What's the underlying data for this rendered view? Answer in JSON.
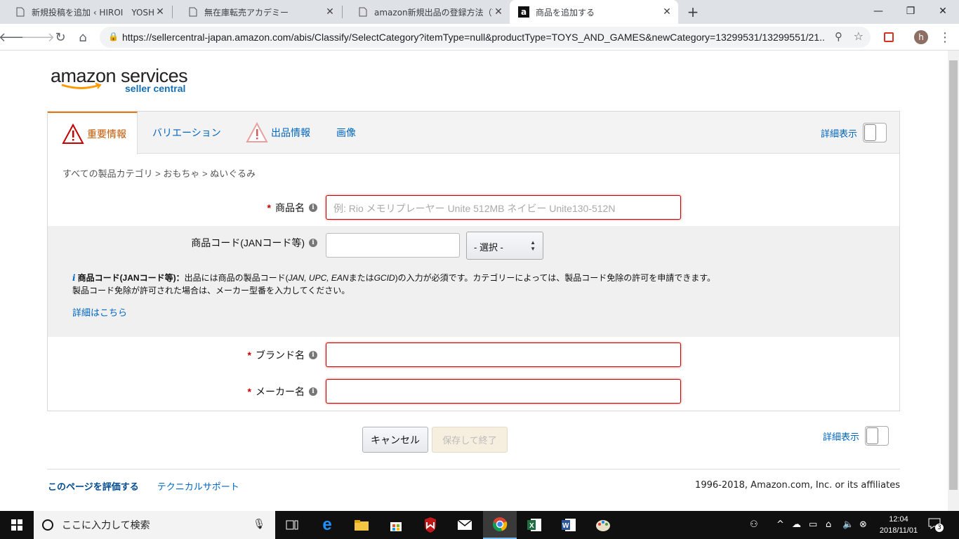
{
  "browser": {
    "tabs": [
      {
        "title": "新規投稿を追加 ‹ HIROI　YOSHIAKI",
        "icon": "page-icon"
      },
      {
        "title": "無在庫転売アカデミー",
        "icon": "page-icon"
      },
      {
        "title": "amazon新規出品の登録方法（商品",
        "icon": "page-icon"
      },
      {
        "title": "商品を追加する",
        "icon": "amazon-icon"
      }
    ],
    "url": "https://sellercentral-japan.amazon.com/abis/Classify/SelectCategory?itemType=null&productType=TOYS_AND_GAMES&newCategory=13299531/13299551/21...",
    "profile_initial": "h"
  },
  "logo": {
    "line1": "amazon services",
    "line2": "seller central"
  },
  "form_tabs": {
    "important": "重要情報",
    "variation": "バリエーション",
    "listing": "出品情報",
    "images": "画像"
  },
  "detail_toggle_label": "詳細表示",
  "breadcrumb": "すべての製品カテゴリ > おもちゃ > ぬいぐるみ",
  "fields": {
    "product_name": {
      "label": "商品名",
      "placeholder": "例: Rio メモリプレーヤー Unite 512MB ネイビー Unite130-512N"
    },
    "product_code": {
      "label": "商品コード(JANコード等)",
      "select": "- 選択 -"
    },
    "brand": {
      "label": "ブランド名"
    },
    "maker": {
      "label": "メーカー名"
    }
  },
  "code_help": {
    "bold": "商品コード(JANコード等)：",
    "text": "出品には商品の製品コード(",
    "italic": "JAN, UPC, EAN",
    "text2": "または",
    "italic2": "GCID",
    "text3": ")の入力が必須です。カテゴリーによっては、製品コード免除の許可を申請できます。製品コード免除が許可された場合は、メーカー型番を入力してください。",
    "more": "詳細はこちら"
  },
  "buttons": {
    "cancel": "キャンセル",
    "save": "保存して終了"
  },
  "footer": {
    "rate": "このページを評価する",
    "support": "テクニカルサポート",
    "copyright": "1996-2018, Amazon.com, Inc. or its affiliates"
  },
  "taskbar": {
    "search_placeholder": "ここに入力して検索",
    "time": "12:04",
    "date": "2018/11/01",
    "notifications": "3"
  }
}
